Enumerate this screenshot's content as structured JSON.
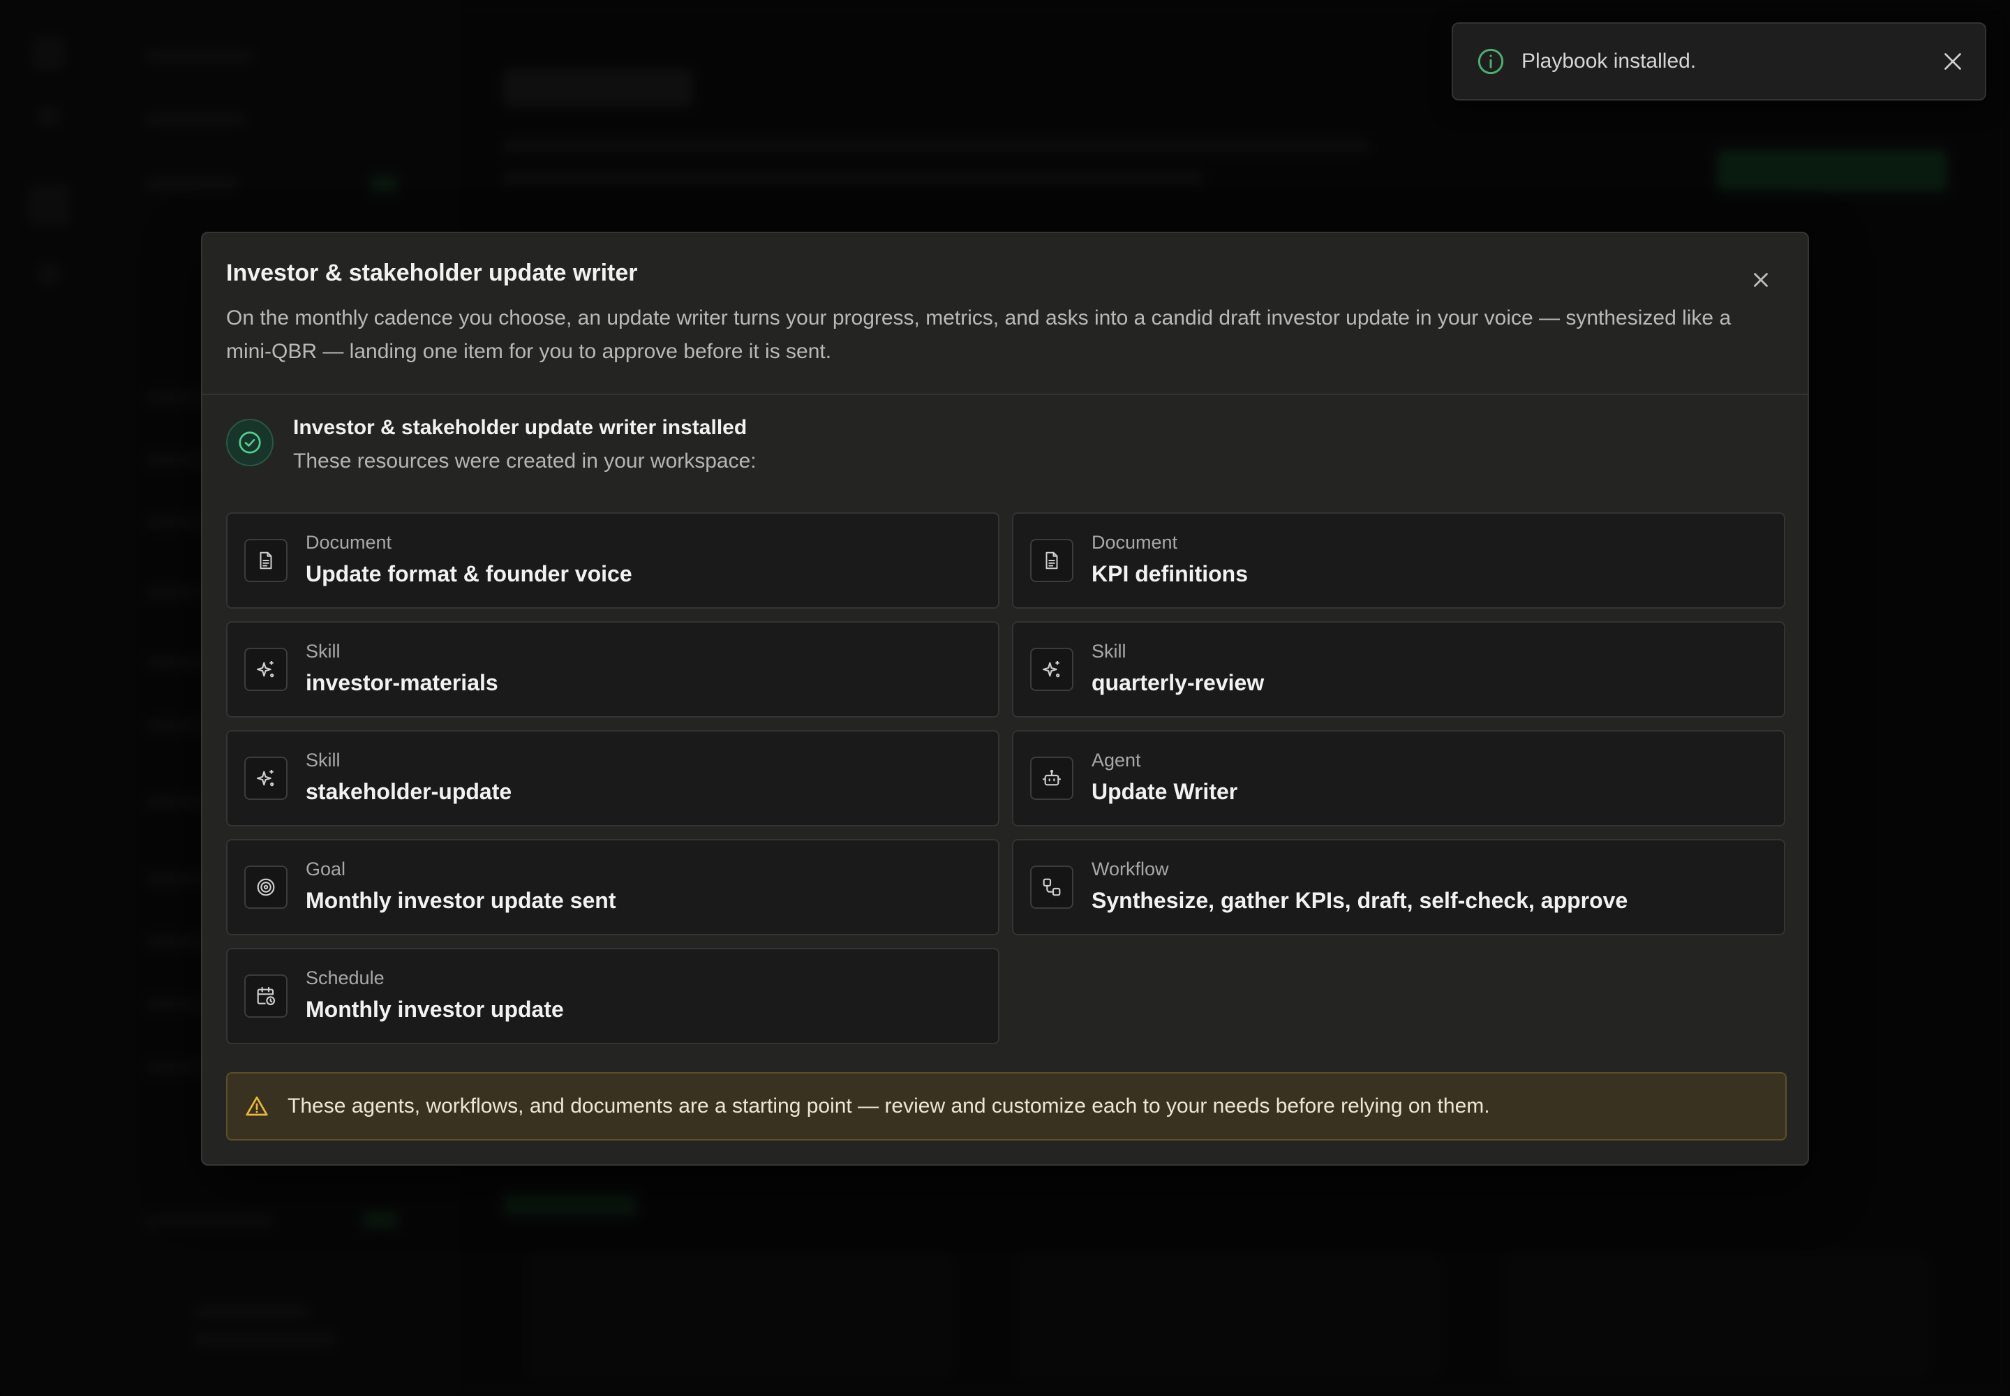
{
  "toast": {
    "message": "Playbook installed.",
    "icon": "info-icon",
    "accent": "#4caf6d"
  },
  "modal": {
    "title": "Investor & stakeholder update writer",
    "description": "On the monthly cadence you choose, an update writer turns your progress, metrics, and asks into a candid draft investor update in your voice — synthesized like a mini-QBR — landing one item for you to approve before it is sent.",
    "installed_title": "Investor & stakeholder update writer installed",
    "installed_subtitle": "These resources were created in your workspace:",
    "resources": [
      {
        "type": "Document",
        "name": "Update format & founder voice",
        "icon": "document-icon"
      },
      {
        "type": "Document",
        "name": "KPI definitions",
        "icon": "document-icon"
      },
      {
        "type": "Skill",
        "name": "investor-materials",
        "icon": "sparkle-icon"
      },
      {
        "type": "Skill",
        "name": "quarterly-review",
        "icon": "sparkle-icon"
      },
      {
        "type": "Skill",
        "name": "stakeholder-update",
        "icon": "sparkle-icon"
      },
      {
        "type": "Agent",
        "name": "Update Writer",
        "icon": "robot-icon"
      },
      {
        "type": "Goal",
        "name": "Monthly investor update sent",
        "icon": "target-icon"
      },
      {
        "type": "Workflow",
        "name": "Synthesize, gather KPIs, draft, self-check, approve",
        "icon": "workflow-icon"
      },
      {
        "type": "Schedule",
        "name": "Monthly investor update",
        "icon": "calendar-clock-icon"
      }
    ],
    "warning": "These agents, workflows, and documents are a starting point — review and customize each to your needs before relying on them.",
    "colors": {
      "success": "#4fcf8f",
      "warning": "#e9b93a"
    }
  }
}
